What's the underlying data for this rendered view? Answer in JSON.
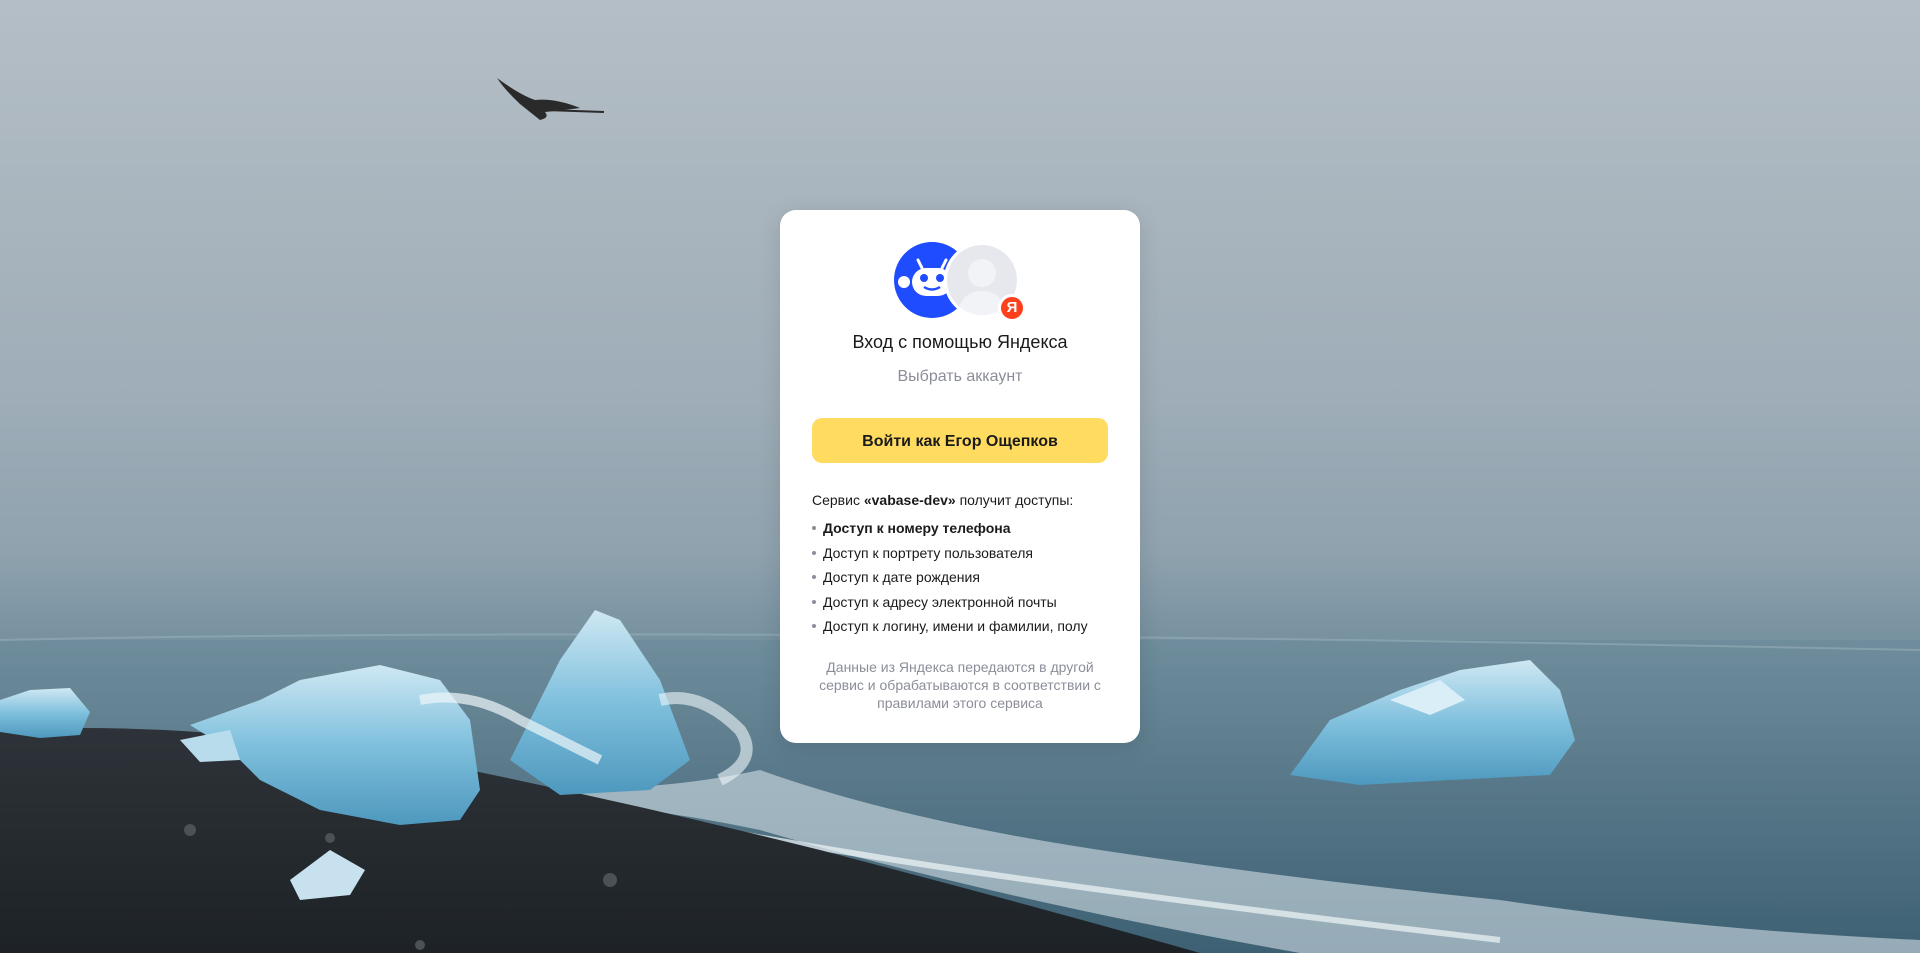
{
  "page": {
    "title": "Вход с помощью Яндекса",
    "choose_account": "Выбрать аккаунт"
  },
  "avatars": {
    "app_icon": "robot-face-icon",
    "user_icon": "user-silhouette-icon",
    "badge_letter": "Я",
    "badge_color": "#fc3f1d",
    "app_color": "#1f4cff"
  },
  "login_button": {
    "label": "Войти как Егор Ощепков",
    "color": "#ffdc60"
  },
  "permissions": {
    "intro_prefix": "Сервис ",
    "service_name": "«vabase-dev»",
    "intro_suffix": " получит доступы:",
    "items": [
      "Доступ к номеру телефона",
      "Доступ к портрету пользователя",
      "Доступ к дате рождения",
      "Доступ к адресу электронной почты",
      "Доступ к логину, имени и фамилии, полу"
    ]
  },
  "footnote": "Данные из Яндекса передаются в другой сервис и обрабатываются в соответствии с правилами этого сервиса"
}
